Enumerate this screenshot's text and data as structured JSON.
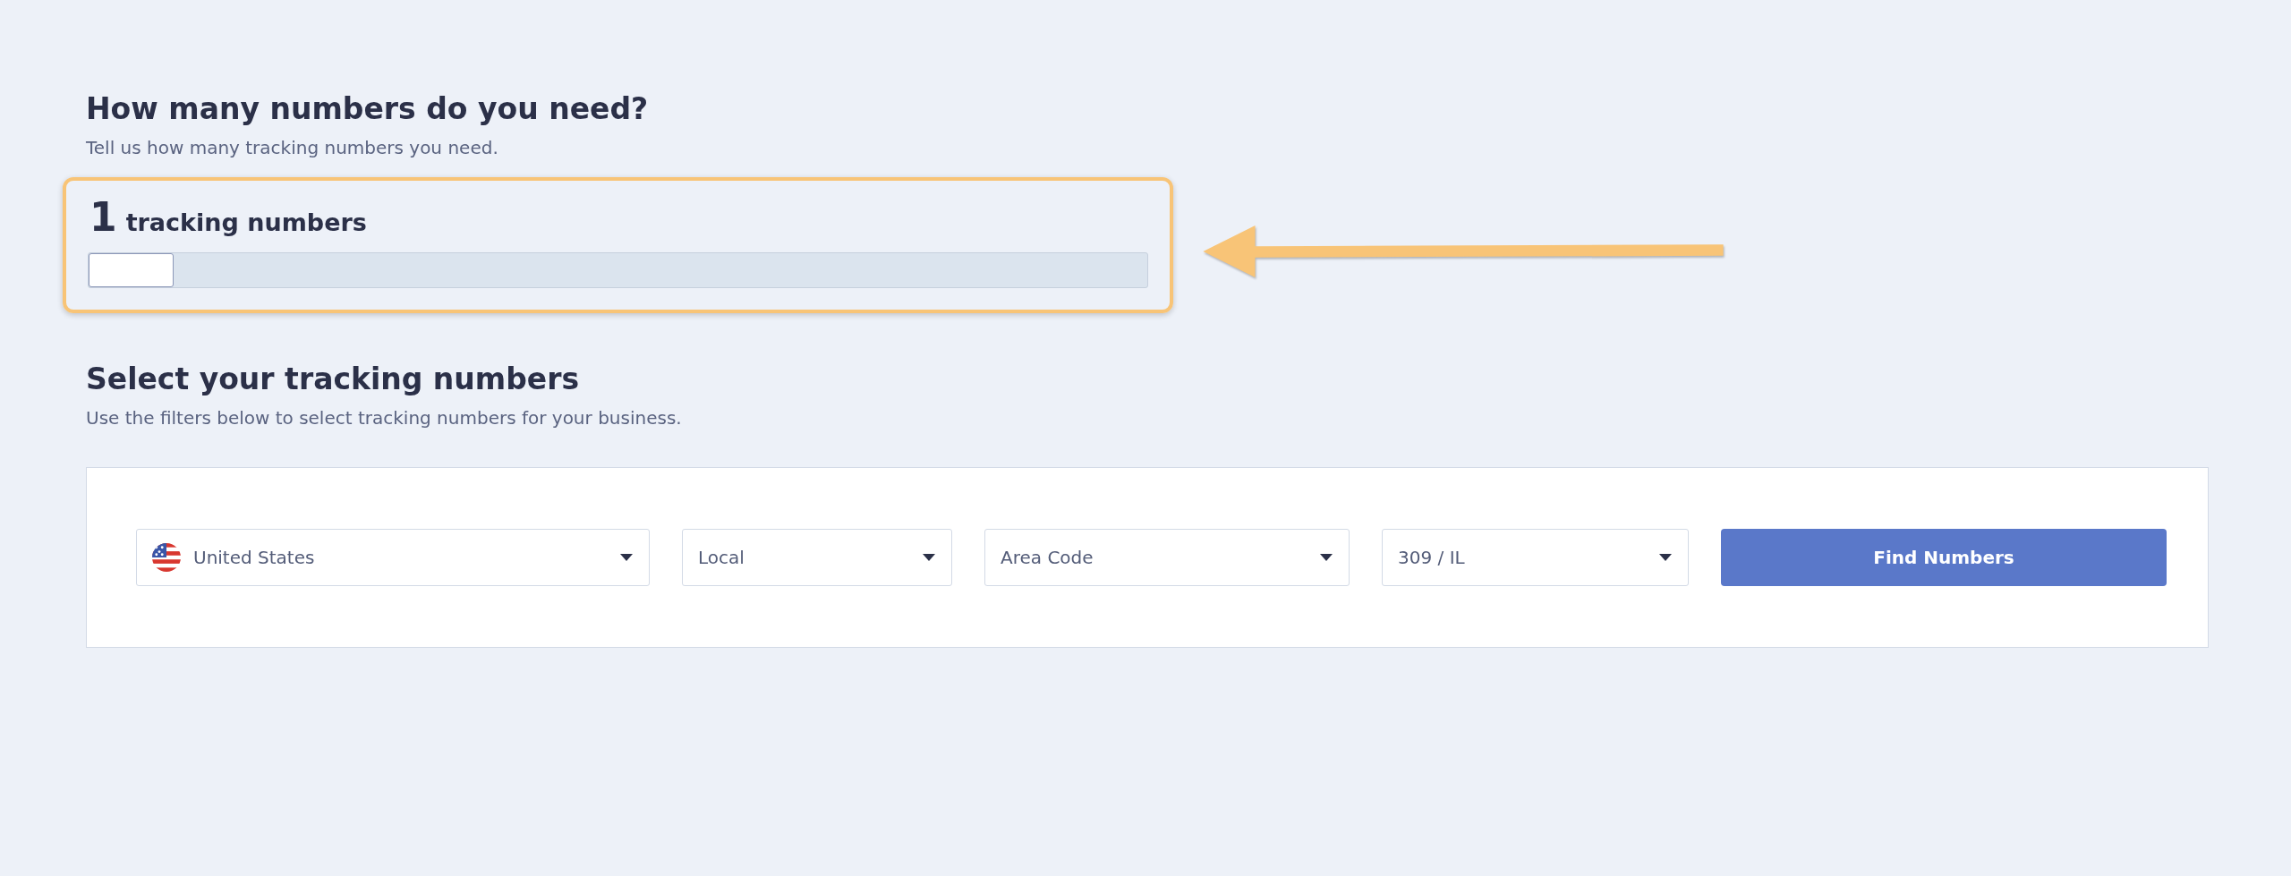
{
  "quantity_section": {
    "heading": "How many numbers do you need?",
    "subtitle": "Tell us how many tracking numbers you need.",
    "count": "1",
    "count_label": "tracking numbers",
    "slider": {
      "level": 0
    }
  },
  "selection_section": {
    "heading": "Select your tracking numbers",
    "subtitle": "Use the filters below to select tracking numbers for your business.",
    "filters": [
      {
        "kind": "country",
        "value": "United States"
      },
      {
        "kind": "select",
        "value": "Local"
      },
      {
        "kind": "select",
        "value": "Area Code"
      },
      {
        "kind": "select",
        "value": "309 / IL"
      }
    ],
    "button": "Find Numbers"
  }
}
